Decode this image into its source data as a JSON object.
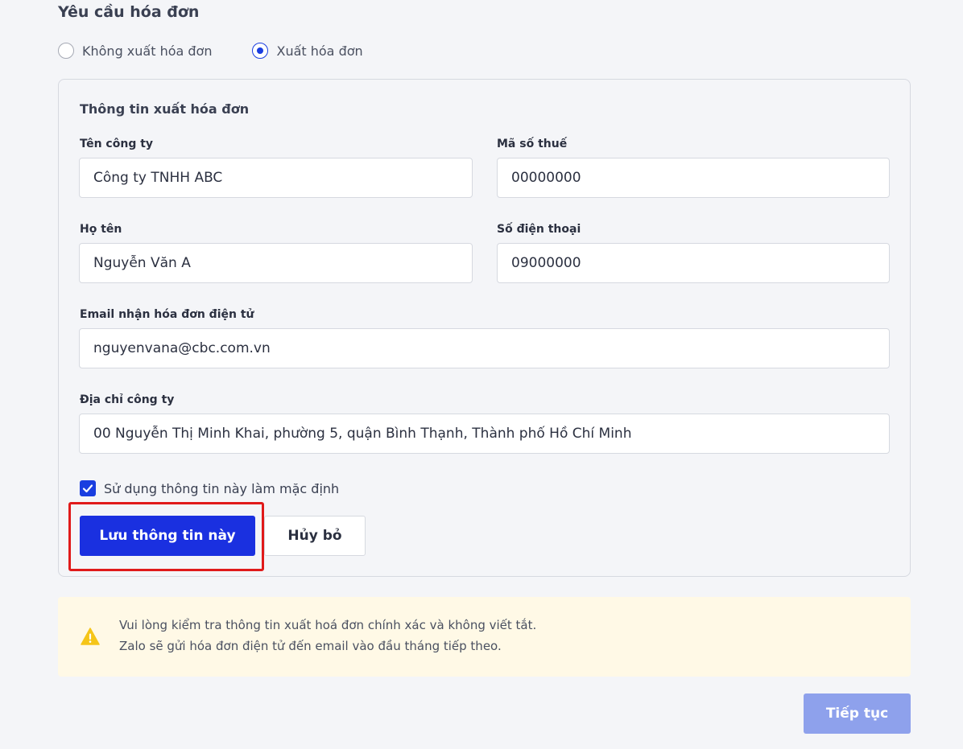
{
  "section": {
    "title": "Yêu cầu hóa đơn"
  },
  "invoice_options": [
    {
      "label": "Không xuất hóa đơn",
      "selected": false
    },
    {
      "label": "Xuất hóa đơn",
      "selected": true
    }
  ],
  "card": {
    "title": "Thông tin xuất hóa đơn",
    "company_name": {
      "label": "Tên công ty",
      "value": "Công ty TNHH ABC"
    },
    "tax_code": {
      "label": "Mã số thuế",
      "value": "00000000"
    },
    "full_name": {
      "label": "Họ tên",
      "value": "Nguyễn Văn A"
    },
    "phone": {
      "label": "Số điện thoại",
      "value": "09000000"
    },
    "email": {
      "label": "Email nhận hóa đơn điện tử",
      "value": "nguyenvana@cbc.com.vn"
    },
    "address": {
      "label": "Địa chỉ công ty",
      "value": "00 Nguyễn Thị Minh Khai, phường 5, quận Bình Thạnh, Thành phố Hồ Chí Minh"
    },
    "default_checkbox": {
      "label": "Sử dụng thông tin này làm mặc định",
      "checked": true
    },
    "save_label": "Lưu thông tin này",
    "cancel_label": "Hủy bỏ"
  },
  "notice": {
    "icon": "warning-icon",
    "line1": "Vui lòng kiểm tra thông tin xuất hoá đơn chính xác và không viết tắt.",
    "line2": "Zalo sẽ gửi hóa đơn điện tử đến email vào đầu tháng tiếp theo."
  },
  "continue_label": "Tiếp tục",
  "colors": {
    "primary": "#1a30e0",
    "highlight": "#e01a1a",
    "notice_bg": "#fff9e6",
    "disabled": "#8ea1ec"
  }
}
